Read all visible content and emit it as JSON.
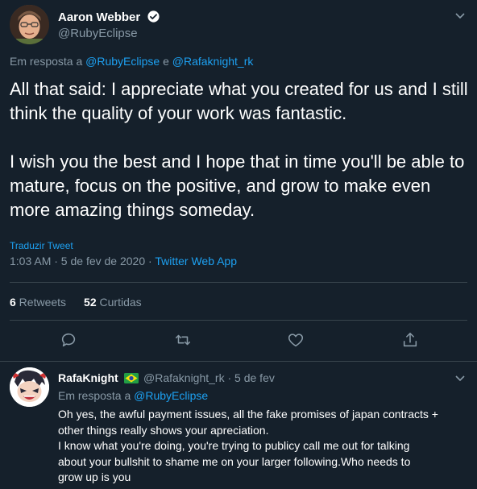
{
  "main_tweet": {
    "author_name": "Aaron Webber",
    "author_handle": "@RubyEclipse",
    "replying_prefix": "Em resposta a ",
    "replying_to_1": "@RubyEclipse",
    "replying_joiner": " e ",
    "replying_to_2": "@Rafaknight_rk",
    "text": "All that said: I appreciate what you created for us and I still think the quality of your work was fantastic.\n\nI wish you the best and I hope that in time you'll be able to mature, focus on the positive, and grow to make even more amazing things someday.",
    "translate_label": "Traduzir Tweet",
    "timestamp": "1:03 AM · 5 de fev de 2020",
    "meta_separator": " · ",
    "source": "Twitter Web App",
    "retweets_count": "6",
    "retweets_label": " Retweets",
    "likes_count": "52",
    "likes_label": " Curtidas"
  },
  "reply_tweet": {
    "author_name": "RafaKnight",
    "author_handle": "@Rafaknight_rk",
    "separator": " · ",
    "date": "5 de fev",
    "replying_prefix": "Em resposta a ",
    "replying_to": "@RubyEclipse",
    "text_lines": [
      "Oh yes, the awful payment issues, all the fake promises of japan contracts +",
      "other things really shows your apreciation.",
      "I know what you're doing, you're trying to publicy call me out for talking",
      "about your bullshit to shame me on your larger following.Who needs to",
      "grow up is you"
    ]
  },
  "icons": [
    "verified-icon",
    "caret-down-icon",
    "reply-icon",
    "retweet-icon",
    "like-icon",
    "share-icon",
    "brazil-flag-icon"
  ],
  "colors": {
    "background": "#15202b",
    "text": "#ffffff",
    "muted": "#8899a6",
    "accent": "#1da1f2",
    "border": "#38444d"
  }
}
